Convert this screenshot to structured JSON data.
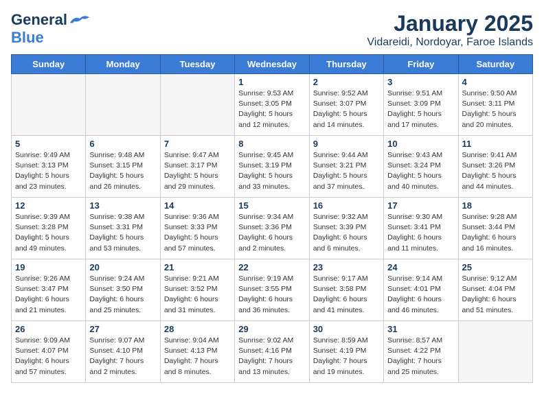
{
  "header": {
    "logo_general": "General",
    "logo_blue": "Blue",
    "title": "January 2025",
    "subtitle": "Vidareidi, Nordoyar, Faroe Islands"
  },
  "weekdays": [
    "Sunday",
    "Monday",
    "Tuesday",
    "Wednesday",
    "Thursday",
    "Friday",
    "Saturday"
  ],
  "weeks": [
    [
      {
        "day": "",
        "info": ""
      },
      {
        "day": "",
        "info": ""
      },
      {
        "day": "",
        "info": ""
      },
      {
        "day": "1",
        "info": "Sunrise: 9:53 AM\nSunset: 3:05 PM\nDaylight: 5 hours\nand 12 minutes."
      },
      {
        "day": "2",
        "info": "Sunrise: 9:52 AM\nSunset: 3:07 PM\nDaylight: 5 hours\nand 14 minutes."
      },
      {
        "day": "3",
        "info": "Sunrise: 9:51 AM\nSunset: 3:09 PM\nDaylight: 5 hours\nand 17 minutes."
      },
      {
        "day": "4",
        "info": "Sunrise: 9:50 AM\nSunset: 3:11 PM\nDaylight: 5 hours\nand 20 minutes."
      }
    ],
    [
      {
        "day": "5",
        "info": "Sunrise: 9:49 AM\nSunset: 3:13 PM\nDaylight: 5 hours\nand 23 minutes."
      },
      {
        "day": "6",
        "info": "Sunrise: 9:48 AM\nSunset: 3:15 PM\nDaylight: 5 hours\nand 26 minutes."
      },
      {
        "day": "7",
        "info": "Sunrise: 9:47 AM\nSunset: 3:17 PM\nDaylight: 5 hours\nand 29 minutes."
      },
      {
        "day": "8",
        "info": "Sunrise: 9:45 AM\nSunset: 3:19 PM\nDaylight: 5 hours\nand 33 minutes."
      },
      {
        "day": "9",
        "info": "Sunrise: 9:44 AM\nSunset: 3:21 PM\nDaylight: 5 hours\nand 37 minutes."
      },
      {
        "day": "10",
        "info": "Sunrise: 9:43 AM\nSunset: 3:24 PM\nDaylight: 5 hours\nand 40 minutes."
      },
      {
        "day": "11",
        "info": "Sunrise: 9:41 AM\nSunset: 3:26 PM\nDaylight: 5 hours\nand 44 minutes."
      }
    ],
    [
      {
        "day": "12",
        "info": "Sunrise: 9:39 AM\nSunset: 3:28 PM\nDaylight: 5 hours\nand 49 minutes."
      },
      {
        "day": "13",
        "info": "Sunrise: 9:38 AM\nSunset: 3:31 PM\nDaylight: 5 hours\nand 53 minutes."
      },
      {
        "day": "14",
        "info": "Sunrise: 9:36 AM\nSunset: 3:33 PM\nDaylight: 5 hours\nand 57 minutes."
      },
      {
        "day": "15",
        "info": "Sunrise: 9:34 AM\nSunset: 3:36 PM\nDaylight: 6 hours\nand 2 minutes."
      },
      {
        "day": "16",
        "info": "Sunrise: 9:32 AM\nSunset: 3:39 PM\nDaylight: 6 hours\nand 6 minutes."
      },
      {
        "day": "17",
        "info": "Sunrise: 9:30 AM\nSunset: 3:41 PM\nDaylight: 6 hours\nand 11 minutes."
      },
      {
        "day": "18",
        "info": "Sunrise: 9:28 AM\nSunset: 3:44 PM\nDaylight: 6 hours\nand 16 minutes."
      }
    ],
    [
      {
        "day": "19",
        "info": "Sunrise: 9:26 AM\nSunset: 3:47 PM\nDaylight: 6 hours\nand 21 minutes."
      },
      {
        "day": "20",
        "info": "Sunrise: 9:24 AM\nSunset: 3:50 PM\nDaylight: 6 hours\nand 25 minutes."
      },
      {
        "day": "21",
        "info": "Sunrise: 9:21 AM\nSunset: 3:52 PM\nDaylight: 6 hours\nand 31 minutes."
      },
      {
        "day": "22",
        "info": "Sunrise: 9:19 AM\nSunset: 3:55 PM\nDaylight: 6 hours\nand 36 minutes."
      },
      {
        "day": "23",
        "info": "Sunrise: 9:17 AM\nSunset: 3:58 PM\nDaylight: 6 hours\nand 41 minutes."
      },
      {
        "day": "24",
        "info": "Sunrise: 9:14 AM\nSunset: 4:01 PM\nDaylight: 6 hours\nand 46 minutes."
      },
      {
        "day": "25",
        "info": "Sunrise: 9:12 AM\nSunset: 4:04 PM\nDaylight: 6 hours\nand 51 minutes."
      }
    ],
    [
      {
        "day": "26",
        "info": "Sunrise: 9:09 AM\nSunset: 4:07 PM\nDaylight: 6 hours\nand 57 minutes."
      },
      {
        "day": "27",
        "info": "Sunrise: 9:07 AM\nSunset: 4:10 PM\nDaylight: 7 hours\nand 2 minutes."
      },
      {
        "day": "28",
        "info": "Sunrise: 9:04 AM\nSunset: 4:13 PM\nDaylight: 7 hours\nand 8 minutes."
      },
      {
        "day": "29",
        "info": "Sunrise: 9:02 AM\nSunset: 4:16 PM\nDaylight: 7 hours\nand 13 minutes."
      },
      {
        "day": "30",
        "info": "Sunrise: 8:59 AM\nSunset: 4:19 PM\nDaylight: 7 hours\nand 19 minutes."
      },
      {
        "day": "31",
        "info": "Sunrise: 8:57 AM\nSunset: 4:22 PM\nDaylight: 7 hours\nand 25 minutes."
      },
      {
        "day": "",
        "info": ""
      }
    ]
  ]
}
